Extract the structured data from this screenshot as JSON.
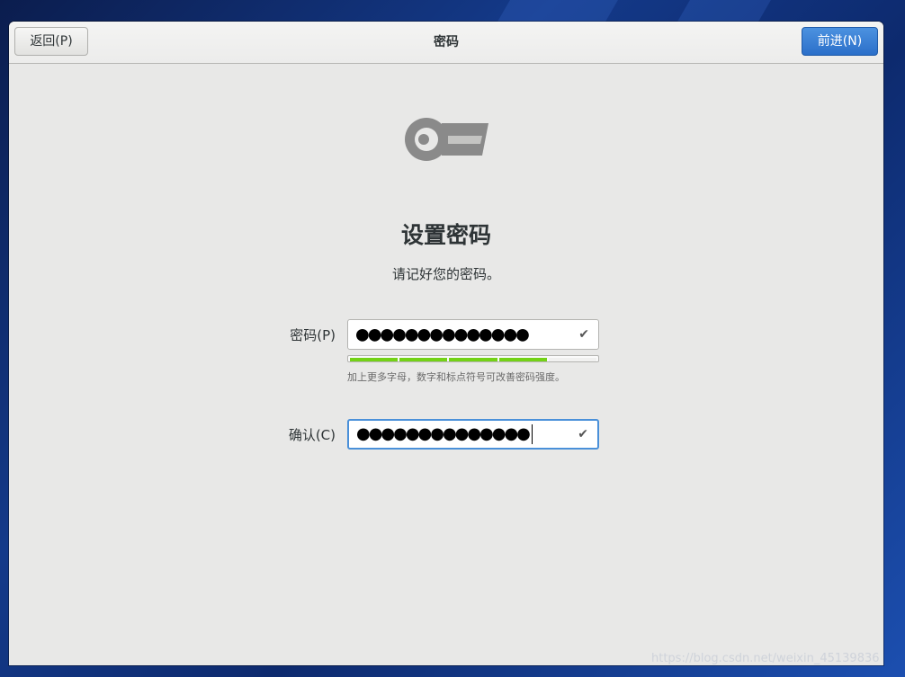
{
  "header": {
    "back_label": "返回(P)",
    "title": "密码",
    "next_label": "前进(N)"
  },
  "icon": "key-icon",
  "main": {
    "heading": "设置密码",
    "subtitle": "请记好您的密码。"
  },
  "password": {
    "label": "密码(P)",
    "value": "●●●●●●●●●●●●●●",
    "status_icon": "check-icon",
    "strength_level": 0.8,
    "hint": "加上更多字母，数字和标点符号可改善密码强度。"
  },
  "confirm": {
    "label": "确认(C)",
    "value": "●●●●●●●●●●●●●●",
    "status_icon": "check-icon"
  },
  "colors": {
    "accent": "#2b6fc9",
    "strength": "#73d216",
    "focus_border": "#4a90d9"
  },
  "watermark": "https://blog.csdn.net/weixin_45139836"
}
